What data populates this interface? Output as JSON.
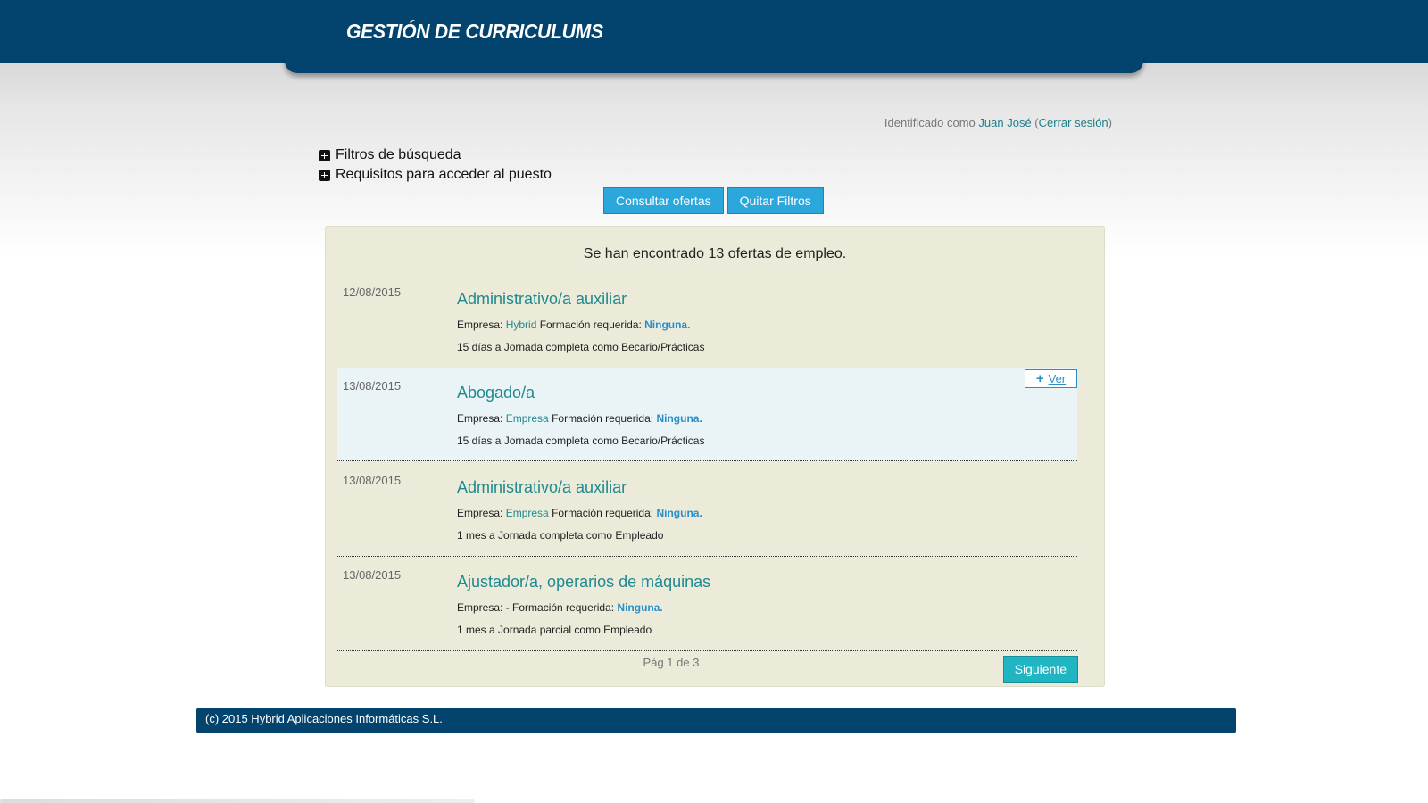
{
  "header": {
    "title": "GESTIÓN DE CURRICULUMS"
  },
  "user": {
    "prefix": "Identificado como ",
    "name": "Juan José",
    "open": " (",
    "logout": "Cerrar sesión",
    "close": ")"
  },
  "toggles": {
    "filters": "Filtros de búsqueda",
    "requirements": "Requisitos para acceder al puesto"
  },
  "buttons": {
    "search": "Consultar ofertas",
    "clear": "Quitar Filtros",
    "next": "Siguiente",
    "view": "Ver"
  },
  "results": {
    "count_text": "Se han encontrado 13 ofertas de empleo.",
    "labels": {
      "company": "Empresa: ",
      "education": "Formación requerida: "
    },
    "offers": [
      {
        "date": "12/08/2015",
        "title": "Administrativo/a auxiliar",
        "company": "Hybrid",
        "education": "Ninguna.",
        "details": "15 días a Jornada completa como Becario/Prácticas"
      },
      {
        "date": "13/08/2015",
        "title": "Abogado/a",
        "company": "Empresa",
        "education": "Ninguna.",
        "details": "15 días a Jornada completa como Becario/Prácticas"
      },
      {
        "date": "13/08/2015",
        "title": "Administrativo/a auxiliar",
        "company": "Empresa",
        "education": "Ninguna.",
        "details": "1 mes a Jornada completa como Empleado"
      },
      {
        "date": "13/08/2015",
        "title": "Ajustador/a, operarios de máquinas",
        "company": "- ",
        "education": "Ninguna.",
        "details": "1 mes a Jornada parcial como Empleado"
      }
    ],
    "pager": "Pág 1 de 3"
  },
  "footer": {
    "text": "(c) 2015 Hybrid Aplicaciones Informáticas S.L."
  }
}
